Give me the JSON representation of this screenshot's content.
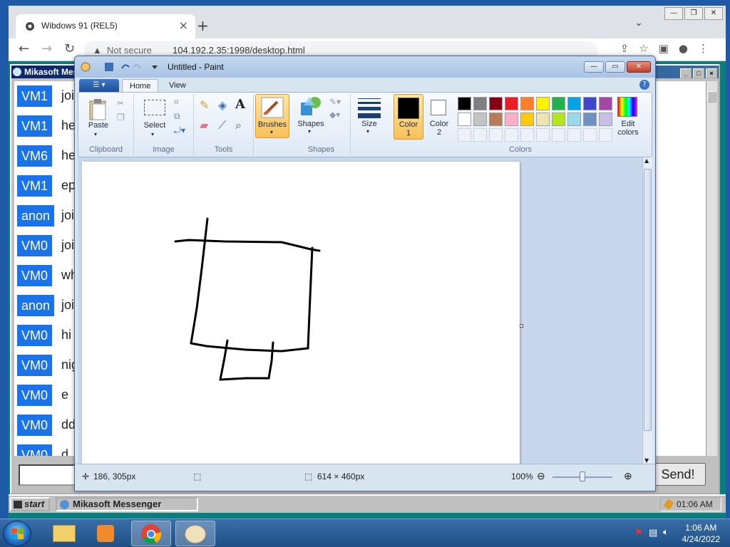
{
  "browser": {
    "tab_title": "Wibdows 91 (REL5)",
    "tab_close": "×",
    "new_tab": "+",
    "tab_list": "⌄",
    "not_secure": "Not secure",
    "url": "104.192.2.35:1998/desktop.html"
  },
  "messenger": {
    "title": "Mikasoft Messenger",
    "messages": [
      {
        "user": "VM1",
        "text": "joi"
      },
      {
        "user": "VM1",
        "text": "he"
      },
      {
        "user": "VM6",
        "text": "he"
      },
      {
        "user": "VM1",
        "text": "ep"
      },
      {
        "user": "anon",
        "text": "joi"
      },
      {
        "user": "VM0",
        "text": "joi"
      },
      {
        "user": "VM0",
        "text": "wh"
      },
      {
        "user": "anon",
        "text": "joi"
      },
      {
        "user": "VM0",
        "text": "hi"
      },
      {
        "user": "VM0",
        "text": "nig"
      },
      {
        "user": "VM0",
        "text": "e"
      },
      {
        "user": "VM0",
        "text": "dd"
      },
      {
        "user": "VM0",
        "text": "d"
      }
    ],
    "send_label": "Send!"
  },
  "w91_taskbar": {
    "start_label": "start",
    "task_label": "Mikasoft Messenger",
    "clock": "01:06 AM"
  },
  "paint": {
    "title": "Untitled - Paint",
    "tabs": [
      "Home",
      "View"
    ],
    "groups": {
      "clipboard": "Clipboard",
      "image": "Image",
      "tools": "Tools",
      "shapes": "Shapes",
      "colors": "Colors"
    },
    "buttons": {
      "paste": "Paste",
      "select": "Select",
      "brushes": "Brushes",
      "shapes": "Shapes",
      "size": "Size",
      "color1": "Color\n1",
      "color2": "Color\n2",
      "edit_colors": "Edit\ncolors"
    },
    "color1_value": "#000000",
    "color2_value": "#ffffff",
    "palette_row1": [
      "#000000",
      "#7f7f7f",
      "#880015",
      "#ed1c24",
      "#ff7f27",
      "#fff200",
      "#22b14c",
      "#00a2e8",
      "#3f48cc",
      "#a349a4"
    ],
    "palette_row2": [
      "#ffffff",
      "#c3c3c3",
      "#b97a57",
      "#ffaec9",
      "#ffc90e",
      "#efe4b0",
      "#b5e61d",
      "#99d9ea",
      "#7092be",
      "#c8bfe7"
    ],
    "status": {
      "cursor_pos": "186, 305px",
      "canvas_size": "614 × 460px",
      "zoom": "100%"
    }
  },
  "host_clock": {
    "time": "1:06 AM",
    "date": "4/24/2022"
  }
}
